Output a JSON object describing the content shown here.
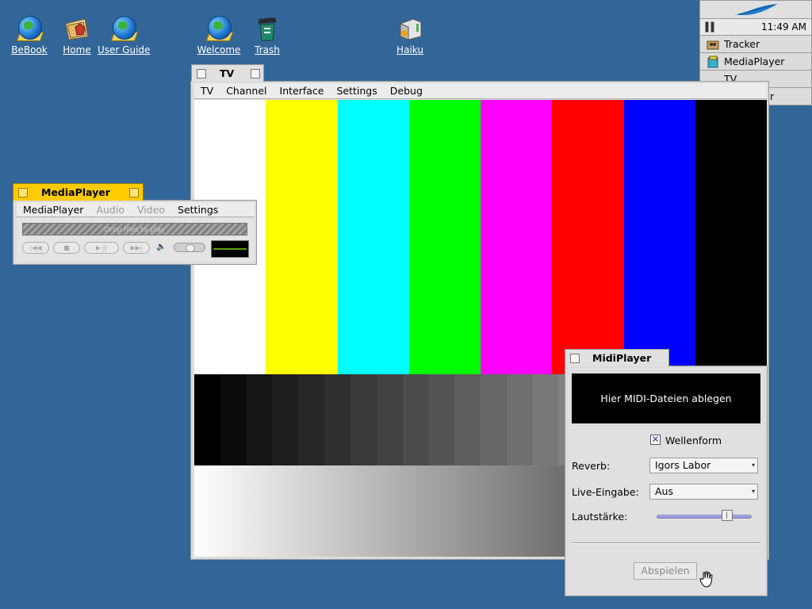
{
  "desktop": {
    "icons": [
      {
        "label": "BeBook",
        "icon": "bebook-icon"
      },
      {
        "label": "Home",
        "icon": "home-folder-icon"
      },
      {
        "label": "User Guide",
        "icon": "user-guide-icon"
      },
      {
        "label": "Welcome",
        "icon": "welcome-icon"
      },
      {
        "label": "Trash",
        "icon": "trash-icon"
      },
      {
        "label": "Haiku",
        "icon": "haiku-volume-icon"
      }
    ],
    "background_color": "#336698"
  },
  "deskbar": {
    "clock": "11:49 AM",
    "items": [
      {
        "label": "Tracker",
        "icon": "tracker-icon"
      },
      {
        "label": "MediaPlayer",
        "icon": "mediaplayer-icon"
      },
      {
        "label": "TV",
        "icon": "tv-icon"
      },
      {
        "label": "r",
        "icon": ""
      }
    ]
  },
  "tv_window": {
    "title": "TV",
    "menu": [
      "TV",
      "Channel",
      "Interface",
      "Settings",
      "Debug"
    ],
    "color_bars": [
      "#ffffff",
      "#ffff00",
      "#00ffff",
      "#00ff00",
      "#ff00ff",
      "#ff0000",
      "#0000ff",
      "#000000"
    ],
    "gray_steps": [
      "#000000",
      "#0b0b0b",
      "#151515",
      "#1e1e1e",
      "#272727",
      "#303030",
      "#393939",
      "#424242",
      "#4b4b4b",
      "#545454",
      "#5d5d5d",
      "#666666",
      "#6f6f6f",
      "#787878",
      "#818181",
      "#8a8a8a",
      "#939393",
      "#9c9c9c",
      "#a5a5a5",
      "#aeaeae",
      "#b7b7b7",
      "#c0c0c0"
    ]
  },
  "mediaplayer_window": {
    "title": "MediaPlayer",
    "menu": [
      {
        "label": "MediaPlayer",
        "disabled": false
      },
      {
        "label": "Audio",
        "disabled": true
      },
      {
        "label": "Video",
        "disabled": true
      },
      {
        "label": "Settings",
        "disabled": false
      }
    ],
    "drop_hint": "Drop files to play",
    "buttons": {
      "skip_back": "|◀◀",
      "stop": "■",
      "play_pause": "▶ ||",
      "skip_forward": "▶▶|"
    },
    "speaker": "🔈",
    "volume": 0.5
  },
  "midiplayer_window": {
    "title": "MidiPlayer",
    "drop_text": "Hier MIDI-Dateien ablegen",
    "checkbox": {
      "label": "Wellenform",
      "checked": true,
      "mark": "✕"
    },
    "reverb": {
      "label": "Reverb:",
      "value": "Igors Labor"
    },
    "live_input": {
      "label": "Live-Eingabe:",
      "value": "Aus"
    },
    "volume": {
      "label": "Lautstärke:",
      "value": 0.75
    },
    "play_button": "Abspielen"
  }
}
